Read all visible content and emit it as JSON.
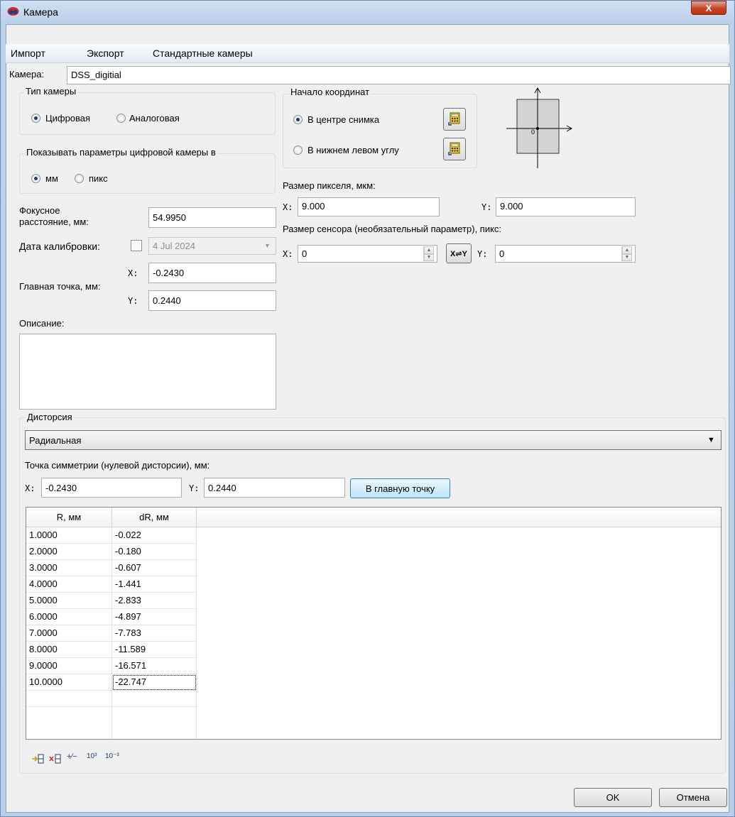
{
  "window": {
    "title": "Камера",
    "close_label": "X"
  },
  "menu": [
    "Импорт",
    "Экспорт",
    "Стандартные камеры"
  ],
  "camera": {
    "label": "Камера:",
    "value": "DSS_digitial"
  },
  "camera_type": {
    "group_label": "Тип камеры",
    "options": [
      {
        "label": "Цифровая",
        "checked": true
      },
      {
        "label": "Аналоговая",
        "checked": false
      }
    ]
  },
  "units": {
    "group_label": "Показывать параметры цифровой камеры в",
    "options": [
      {
        "label": "мм",
        "checked": true
      },
      {
        "label": "пикс",
        "checked": false
      }
    ]
  },
  "origin": {
    "group_label": "Начало координат",
    "options": [
      {
        "label": "В центре снимка",
        "checked": true
      },
      {
        "label": "В нижнем левом углу",
        "checked": false
      }
    ],
    "diagram_label": "0"
  },
  "pixel_size": {
    "label": "Размер пикселя, мкм:",
    "x_label": "X:",
    "x": "9.000",
    "y_label": "Y:",
    "y": "9.000"
  },
  "sensor_size": {
    "label": "Размер сенсора (необязательный параметр), пикс:",
    "x_label": "X:",
    "x": "0",
    "swap_label": "X⇌Y",
    "y_label": "Y:",
    "y": "0"
  },
  "focal": {
    "label_line1": "Фокусное",
    "label_line2": "расстояние, мм:",
    "value": "54.9950"
  },
  "calibration": {
    "label": "Дата калибровки:",
    "checked": false,
    "date": "4 Jul 2024"
  },
  "principal_point": {
    "label": "Главная точка, мм:",
    "x_label": "X:",
    "x": "-0.2430",
    "y_label": "Y:",
    "y": "0.2440"
  },
  "description": {
    "label": "Описание:",
    "value": ""
  },
  "distortion": {
    "group_label": "Дисторсия",
    "type": "Радиальная",
    "symmetry_label": "Точка симметрии (нулевой дисторсии), мм:",
    "x_label": "X:",
    "x": "-0.2430",
    "y_label": "Y:",
    "y": "0.2440",
    "to_principal_label": "В главную точку",
    "columns": [
      "R, мм",
      "dR, мм"
    ],
    "rows": [
      [
        "1.0000",
        "-0.022"
      ],
      [
        "2.0000",
        "-0.180"
      ],
      [
        "3.0000",
        "-0.607"
      ],
      [
        "4.0000",
        "-1.441"
      ],
      [
        "5.0000",
        "-2.833"
      ],
      [
        "6.0000",
        "-4.897"
      ],
      [
        "7.0000",
        "-7.783"
      ],
      [
        "8.0000",
        "-11.589"
      ],
      [
        "9.0000",
        "-16.571"
      ],
      [
        "10.0000",
        "-22.747"
      ]
    ],
    "tools": [
      "insert-row",
      "delete-row",
      "invert-sign",
      "multiply-1000",
      "divide-1000"
    ],
    "tool_labels": [
      "⇒▤",
      "✖▤",
      "+∕−",
      "10³",
      "10⁻³"
    ]
  },
  "ok_label": "OK",
  "cancel_label": "Отмена",
  "colors": {
    "accent": "#1e3c6b",
    "close": "#c6452a",
    "calc_icon": "#e8c23a"
  }
}
